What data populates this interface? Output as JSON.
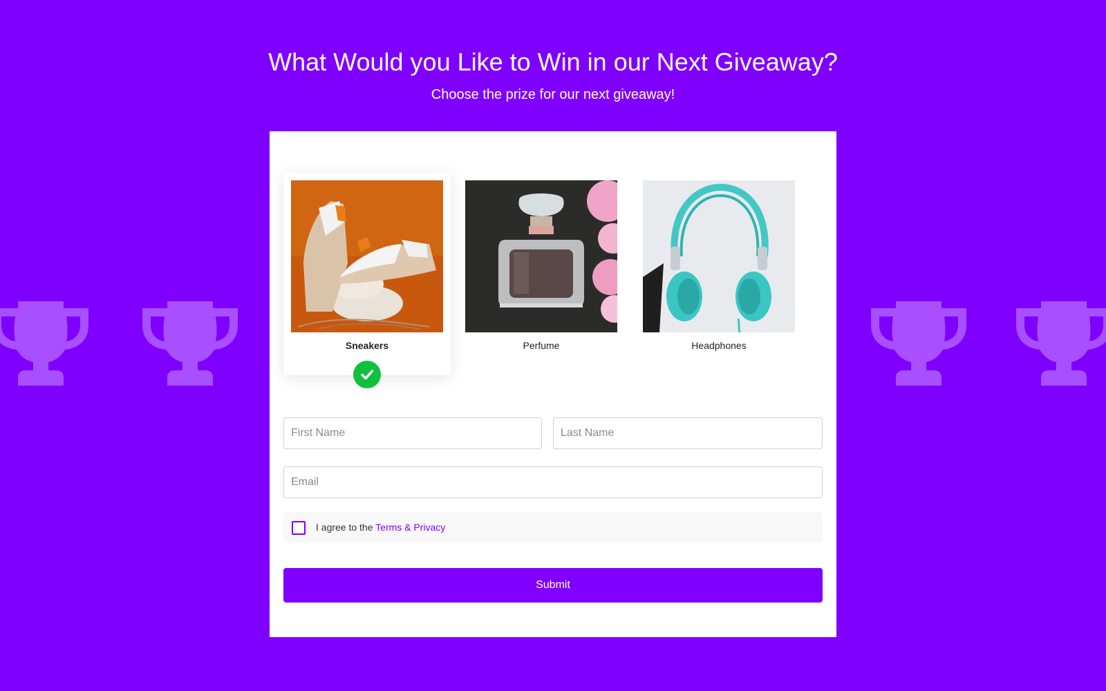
{
  "header": {
    "title": "What Would you Like to Win in our Next Giveaway?",
    "subtitle": "Choose the prize for our next giveaway!"
  },
  "background": {
    "color": "#8000ff",
    "decoration_icon": "trophy-icon"
  },
  "prizes": [
    {
      "label": "Sneakers",
      "selected": true,
      "image": "sneakers-photo"
    },
    {
      "label": "Perfume",
      "selected": false,
      "image": "perfume-photo"
    },
    {
      "label": "Headphones",
      "selected": false,
      "image": "headphones-photo"
    }
  ],
  "form": {
    "first_name": {
      "placeholder": "First Name",
      "value": ""
    },
    "last_name": {
      "placeholder": "Last Name",
      "value": ""
    },
    "email": {
      "placeholder": "Email",
      "value": ""
    },
    "consent": {
      "prefix": "I agree to the",
      "link_text": "Terms & Privacy",
      "checked": false
    },
    "submit_label": "Submit"
  },
  "colors": {
    "accent": "#8000ff",
    "check": "#11c03c",
    "card": "#ffffff"
  }
}
